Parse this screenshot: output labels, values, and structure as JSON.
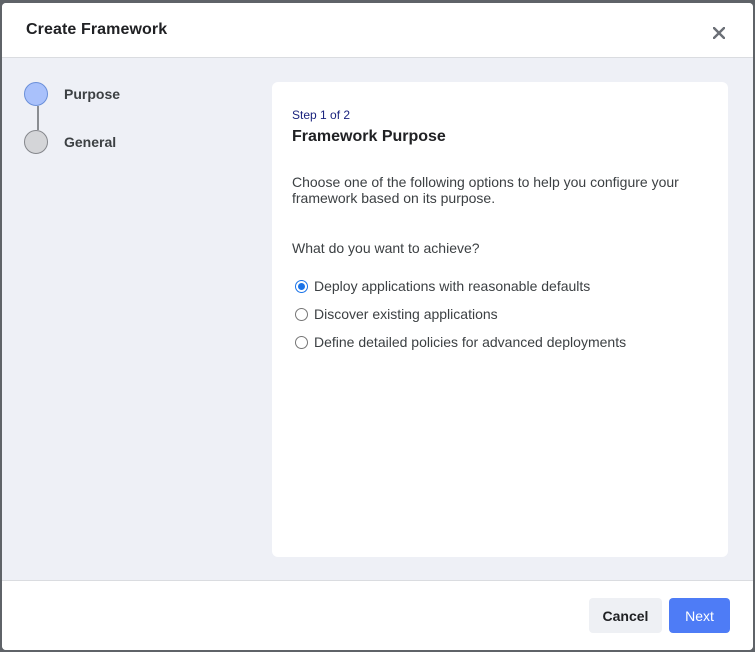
{
  "modal": {
    "title": "Create Framework",
    "close_icon": "close-icon"
  },
  "stepper": {
    "steps": [
      {
        "label": "Purpose",
        "state": "active"
      },
      {
        "label": "General",
        "state": "inactive"
      }
    ]
  },
  "card": {
    "step_counter": "Step 1 of 2",
    "title": "Framework Purpose",
    "description": "Choose one of the following options to help you configure your framework based on its purpose.",
    "question": "What do you want to achieve?",
    "options": [
      {
        "label": "Deploy applications with reasonable defaults",
        "selected": true
      },
      {
        "label": "Discover existing applications",
        "selected": false
      },
      {
        "label": "Define detailed policies for advanced deployments",
        "selected": false
      }
    ]
  },
  "footer": {
    "cancel_label": "Cancel",
    "next_label": "Next"
  },
  "colors": {
    "accent": "#4e7cf6",
    "active_step": "#a9c1fb",
    "body_bg": "#eef0f6"
  }
}
